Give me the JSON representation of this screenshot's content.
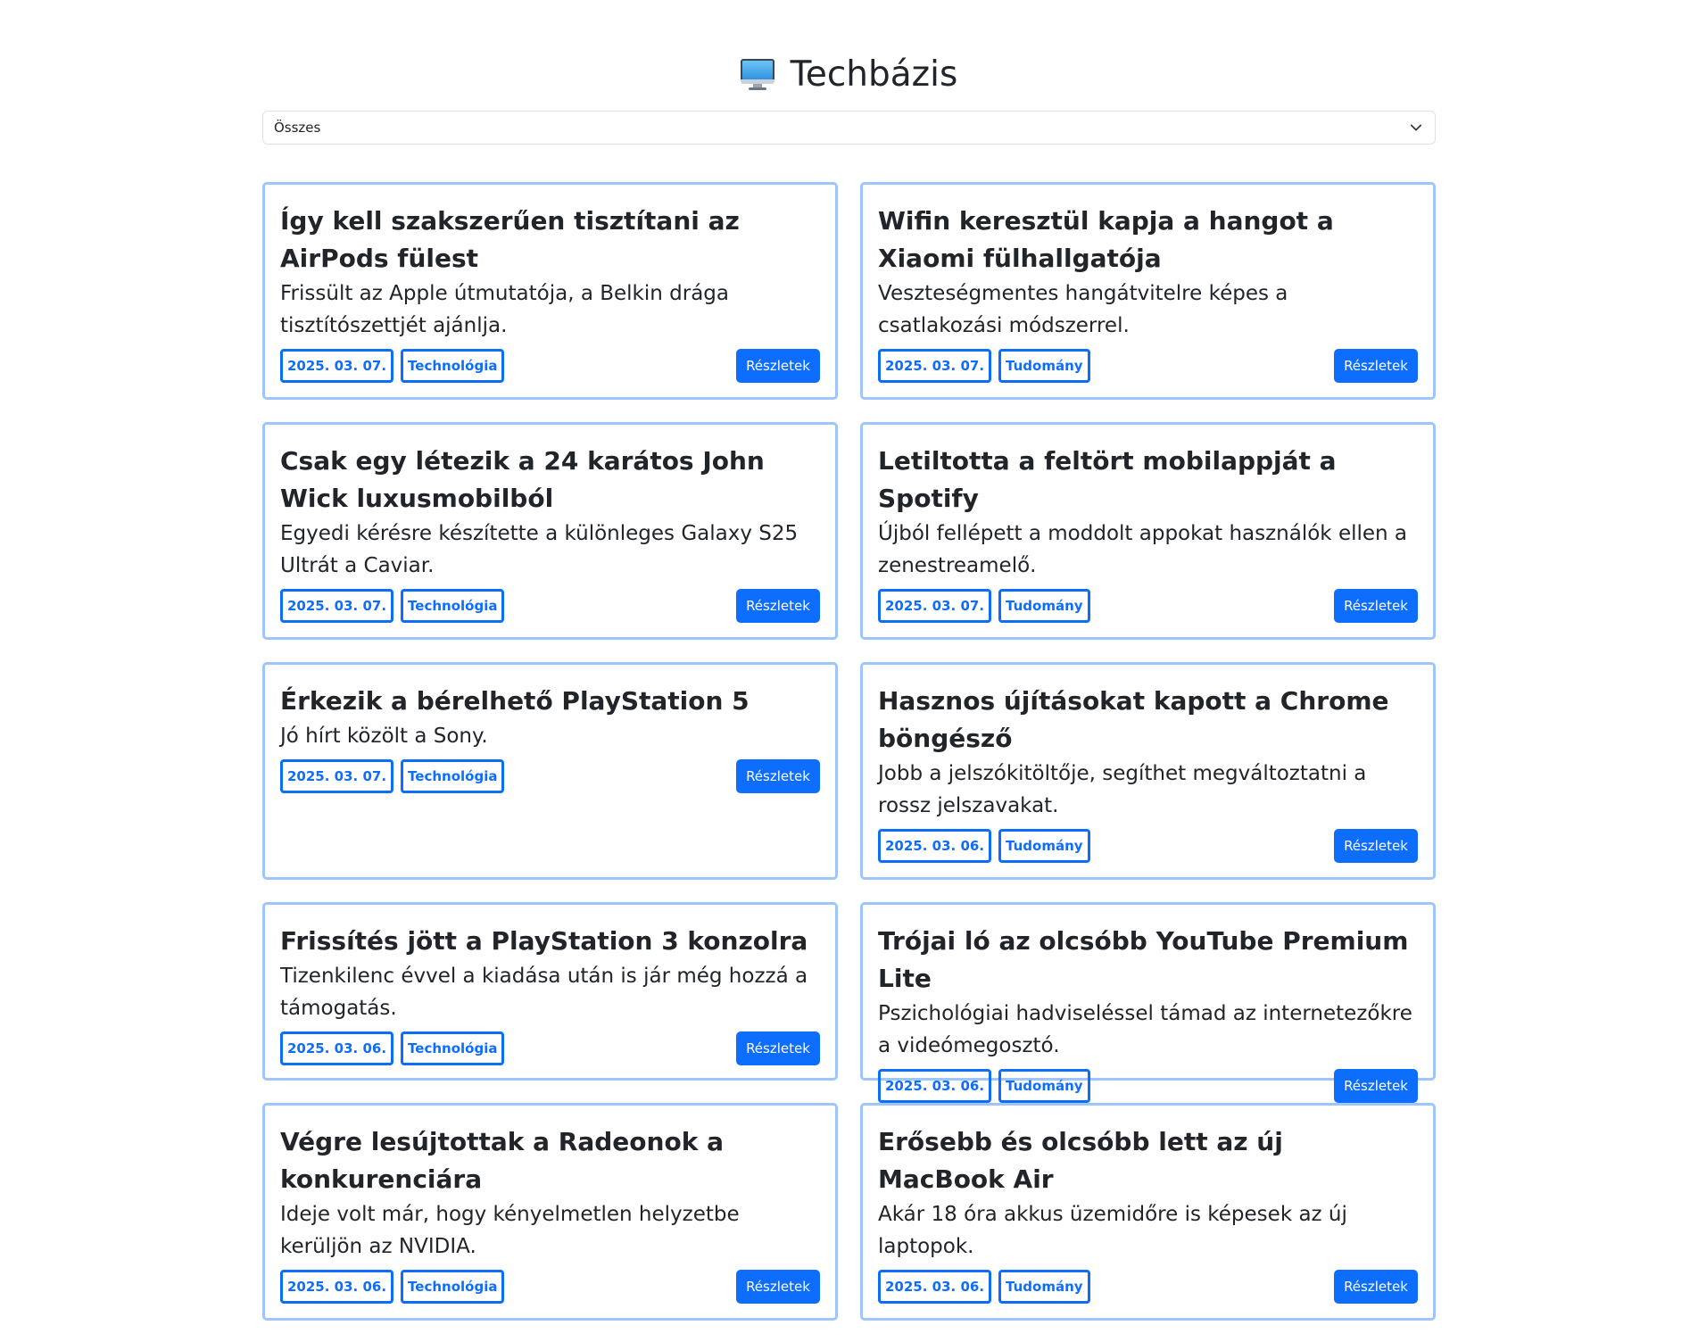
{
  "header": {
    "title": "Techbázis",
    "icon": "computer-monitor-icon"
  },
  "filter": {
    "selected": "Összes"
  },
  "articles": [
    {
      "title": "Így kell szakszerűen tisztítani az AirPods fülest",
      "lead": "Frissült az Apple útmutatója, a Belkin drága tisztítószettjét ajánlja.",
      "date": "2025. 03. 07.",
      "category": "Technológia",
      "button": "Részletek"
    },
    {
      "title": "Wifin keresztül kapja a hangot a Xiaomi fülhallgatója",
      "lead": "Veszteségmentes hangátvitelre képes a csatlakozási módszerrel.",
      "date": "2025. 03. 07.",
      "category": "Tudomány",
      "button": "Részletek"
    },
    {
      "title": "Csak egy létezik a 24 karátos John Wick luxusmobilból",
      "lead": "Egyedi kérésre készítette a különleges Galaxy S25 Ultrát a Caviar.",
      "date": "2025. 03. 07.",
      "category": "Technológia",
      "button": "Részletek"
    },
    {
      "title": "Letiltotta a feltört mobilappját a Spotify",
      "lead": "Újból fellépett a moddolt appokat használók ellen a zenestreamelő.",
      "date": "2025. 03. 07.",
      "category": "Tudomány",
      "button": "Részletek"
    },
    {
      "title": "Érkezik a bérelhető PlayStation 5",
      "lead": "Jó hírt közölt a Sony.",
      "date": "2025. 03. 07.",
      "category": "Technológia",
      "button": "Részletek"
    },
    {
      "title": "Hasznos újításokat kapott a Chrome böngésző",
      "lead": "Jobb a jelszókitöltője, segíthet megváltoztatni a rossz jelszavakat.",
      "date": "2025. 03. 06.",
      "category": "Tudomány",
      "button": "Részletek"
    },
    {
      "title": "Frissítés jött a PlayStation 3 konzolra",
      "lead": "Tizenkilenc évvel a kiadása után is jár még hozzá a támogatás.",
      "date": "2025. 03. 06.",
      "category": "Technológia",
      "button": "Részletek"
    },
    {
      "title": "Trójai ló az olcsóbb YouTube Premium Lite",
      "lead": "Pszichológiai hadviseléssel támad az internetezőkre a videómegosztó.",
      "date": "2025. 03. 06.",
      "category": "Tudomány",
      "button": "Részletek"
    },
    {
      "title": "Végre lesújtottak a Radeonok a konkurenciára",
      "lead": "Ideje volt már, hogy kényelmetlen helyzetbe kerüljön az NVIDIA.",
      "date": "2025. 03. 06.",
      "category": "Technológia",
      "button": "Részletek"
    },
    {
      "title": "Erősebb és olcsóbb lett az új MacBook Air",
      "lead": "Akár 18 óra akkus üzemidőre is képesek az új laptopok.",
      "date": "2025. 03. 06.",
      "category": "Tudomány",
      "button": "Részletek"
    }
  ]
}
